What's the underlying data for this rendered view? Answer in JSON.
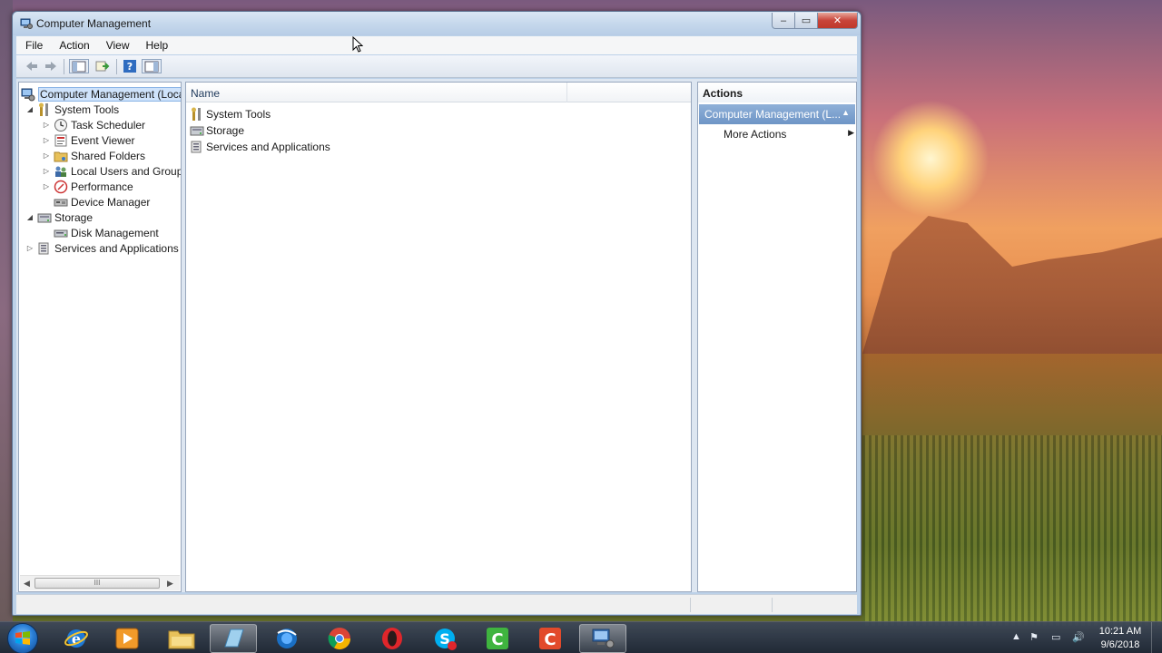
{
  "window": {
    "title": "Computer Management",
    "caption_close": "✕",
    "caption_min": "–",
    "caption_max": "▭"
  },
  "menu": [
    "File",
    "Action",
    "View",
    "Help"
  ],
  "tree": {
    "root": "Computer Management (Local",
    "system_tools": "System Tools",
    "task_scheduler": "Task Scheduler",
    "event_viewer": "Event Viewer",
    "shared_folders": "Shared Folders",
    "local_users": "Local Users and Groups",
    "performance": "Performance",
    "device_manager": "Device Manager",
    "storage": "Storage",
    "disk_management": "Disk Management",
    "services": "Services and Applications",
    "scroll_thumb": "III"
  },
  "list": {
    "column_name": "Name",
    "items": [
      "System Tools",
      "Storage",
      "Services and Applications"
    ]
  },
  "actions": {
    "title": "Actions",
    "group": "Computer Management (L...",
    "more": "More Actions"
  },
  "taskbar": {
    "time": "10:21 AM",
    "date": "9/6/2018",
    "apps": [
      "windows-explorer-ie",
      "media-player",
      "file-explorer",
      "notepad",
      "firefox-like",
      "chrome",
      "opera",
      "skype",
      "camtasia-green",
      "camtasia-red",
      "computer-management"
    ]
  },
  "colors": {
    "selection_bg": "#cfe3fb",
    "actions_header": "#6e95c6",
    "title_bar": "#c6d8ec",
    "close_button": "#c0392b"
  }
}
